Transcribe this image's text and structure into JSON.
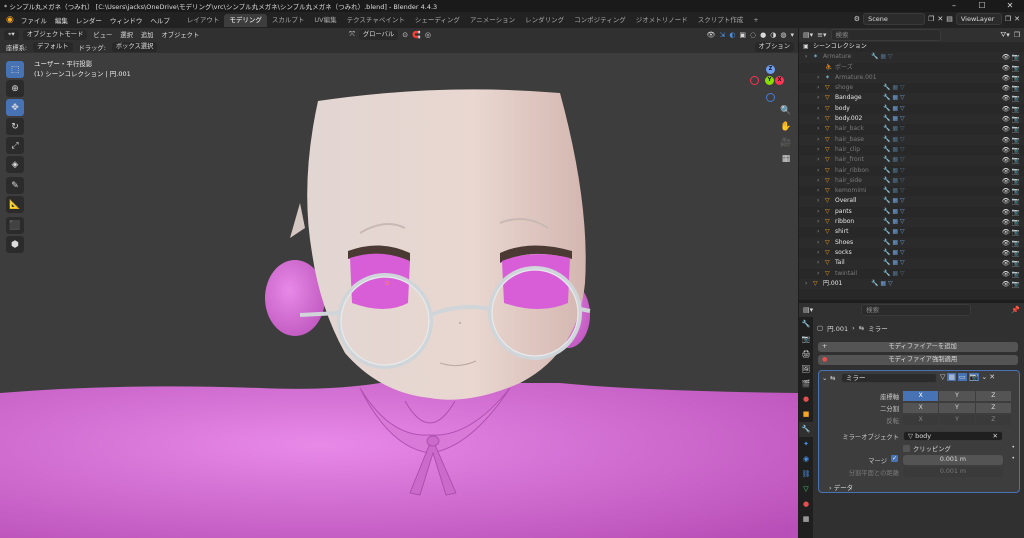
{
  "window": {
    "title": "* シンプル丸メガネ（つみれ） [C:\\Users\\jacks\\OneDrive\\モデリング\\vrc\\シンプル丸メガネ\\シンプル丸メガネ（つみれ）.blend] - Blender 4.4.3"
  },
  "menu": [
    "ファイル",
    "編集",
    "レンダー",
    "ウィンドウ",
    "ヘルプ"
  ],
  "workspaces": [
    "レイアウト",
    "モデリング",
    "スカルプト",
    "UV編集",
    "テクスチャペイント",
    "シェーディング",
    "アニメーション",
    "レンダリング",
    "コンポジティング",
    "ジオメトリノード",
    "スクリプト作成"
  ],
  "active_workspace": "モデリング",
  "scene": "Scene",
  "view_layer": "ViewLayer",
  "viewport_header": {
    "mode": "オブジェクトモード",
    "menus": [
      "ビュー",
      "選択",
      "追加",
      "オブジェクト"
    ],
    "transform": "グローバル",
    "options": "オプション"
  },
  "viewport_header2": {
    "coord_label": "座標系:",
    "coord_value": "デフォルト",
    "drag_label": "ドラッグ:",
    "drag_value": "ボックス選択"
  },
  "viewport_overlay": {
    "view_name": "ユーザー・平行投影",
    "collection_info": "(1) シーンコレクション | 円.001"
  },
  "gizmo": {
    "x": "X",
    "y": "Y",
    "z": "Z"
  },
  "outliner": {
    "search_placeholder": "検索",
    "root": "シーンコレクション",
    "rows": [
      {
        "name": "Armature",
        "dim": true,
        "indent": 0
      },
      {
        "name": "ポーズ",
        "dim": true,
        "indent": 1
      },
      {
        "name": "Armature.001",
        "dim": true,
        "indent": 1
      },
      {
        "name": "shoge",
        "dim": true,
        "indent": 1
      },
      {
        "name": "Bandage",
        "dim": false,
        "indent": 1
      },
      {
        "name": "body",
        "dim": false,
        "indent": 1
      },
      {
        "name": "body.002",
        "dim": false,
        "indent": 1
      },
      {
        "name": "hair_back",
        "dim": true,
        "indent": 1
      },
      {
        "name": "hair_base",
        "dim": true,
        "indent": 1
      },
      {
        "name": "hair_clip",
        "dim": true,
        "indent": 1
      },
      {
        "name": "hair_front",
        "dim": true,
        "indent": 1
      },
      {
        "name": "hair_ribbon",
        "dim": true,
        "indent": 1
      },
      {
        "name": "hair_side",
        "dim": true,
        "indent": 1
      },
      {
        "name": "kemomimi",
        "dim": true,
        "indent": 1
      },
      {
        "name": "Overall",
        "dim": false,
        "indent": 1
      },
      {
        "name": "pants",
        "dim": false,
        "indent": 1
      },
      {
        "name": "ribbon",
        "dim": false,
        "indent": 1
      },
      {
        "name": "shirt",
        "dim": false,
        "indent": 1
      },
      {
        "name": "Shoes",
        "dim": false,
        "indent": 1
      },
      {
        "name": "socks",
        "dim": false,
        "indent": 1
      },
      {
        "name": "Tail",
        "dim": false,
        "indent": 1
      },
      {
        "name": "twintail",
        "dim": true,
        "indent": 1
      },
      {
        "name": "円.001",
        "dim": false,
        "indent": 0
      }
    ]
  },
  "properties": {
    "search_placeholder": "検索",
    "breadcrumb_object": "円.001",
    "breadcrumb_modifier": "ミラー",
    "add_modifier": "モディファイアーを追加",
    "apply_all": "モディファイア強制適用",
    "modifier_name": "ミラー",
    "axis_label": "座標軸",
    "bisect_label": "二分割",
    "flip_label": "反転",
    "axes": [
      "X",
      "Y",
      "Z"
    ],
    "mirror_object_label": "ミラーオブジェクト",
    "mirror_object": "body",
    "clipping": "クリッピング",
    "merge_label": "マージ",
    "merge_value": "0.001 m",
    "bisect_distance_label": "分割平面との距離",
    "bisect_distance_value": "0.001 m",
    "data_panel": "データ"
  },
  "colors": {
    "accent": "#4772b3",
    "skin": "#e8dcd5",
    "pink": "#d75fd7"
  }
}
